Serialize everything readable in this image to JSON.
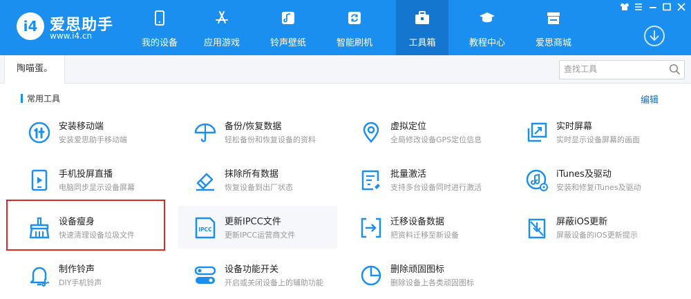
{
  "app": {
    "logo_badge": "i4",
    "logo_name": "爱思助手",
    "logo_url": "www.i4.cn"
  },
  "nav": [
    {
      "label": "我的设备",
      "icon": "phone-icon"
    },
    {
      "label": "应用游戏",
      "icon": "app-store-icon"
    },
    {
      "label": "铃声壁纸",
      "icon": "music-icon"
    },
    {
      "label": "智能刷机",
      "icon": "refresh-icon"
    },
    {
      "label": "工具箱",
      "icon": "toolbox-icon",
      "active": true
    },
    {
      "label": "教程中心",
      "icon": "graduation-cap-icon"
    },
    {
      "label": "爱思商城",
      "icon": "shop-icon"
    }
  ],
  "tab": {
    "label": "陶喵蛋。"
  },
  "search": {
    "placeholder": "查找工具"
  },
  "section": {
    "title": "常用工具",
    "edit_label": "编辑"
  },
  "tools": [
    {
      "name": "安装移动端",
      "desc": "安装爱思助手移动端",
      "icon": "install-mobile-icon"
    },
    {
      "name": "备份/恢复数据",
      "desc": "轻松备份和恢复设备的资料",
      "icon": "umbrella-icon"
    },
    {
      "name": "虚拟定位",
      "desc": "全局修改设备GPS定位信息",
      "icon": "location-pin-icon"
    },
    {
      "name": "实时屏幕",
      "desc": "实时显示设备屏幕的画面",
      "icon": "live-screen-icon"
    },
    {
      "name": "手机投屏直播",
      "desc": "电脑同步显示设备屏幕",
      "icon": "screen-cast-icon"
    },
    {
      "name": "抹除所有数据",
      "desc": "恢复设备到出厂状态",
      "icon": "eraser-icon"
    },
    {
      "name": "批量激活",
      "desc": "支持多台设备同时进行激活",
      "icon": "batch-activate-icon"
    },
    {
      "name": "iTunes及驱动",
      "desc": "安装和修复iTunes及驱动",
      "icon": "itunes-icon"
    },
    {
      "name": "设备瘦身",
      "desc": "快速清理设备垃圾文件",
      "icon": "broom-icon"
    },
    {
      "name": "更新IPCC文件",
      "desc": "更新IPCC运营商文件",
      "icon": "ipcc-file-icon",
      "icon_text": "IPCC"
    },
    {
      "name": "迁移设备数据",
      "desc": "把资料迁移至新设备",
      "icon": "migrate-icon"
    },
    {
      "name": "屏蔽iOS更新",
      "desc": "屏蔽设备的iOS更新提示",
      "icon": "block-update-icon"
    },
    {
      "name": "制作铃声",
      "desc": "DIY手机铃声",
      "icon": "bell-icon"
    },
    {
      "name": "设备功能开关",
      "desc": "开启或关闭设备上的辅助功能",
      "icon": "toggle-icon"
    },
    {
      "name": "删除顽固图标",
      "desc": "删除设备上各类顽固图标",
      "icon": "pie-icon"
    }
  ]
}
